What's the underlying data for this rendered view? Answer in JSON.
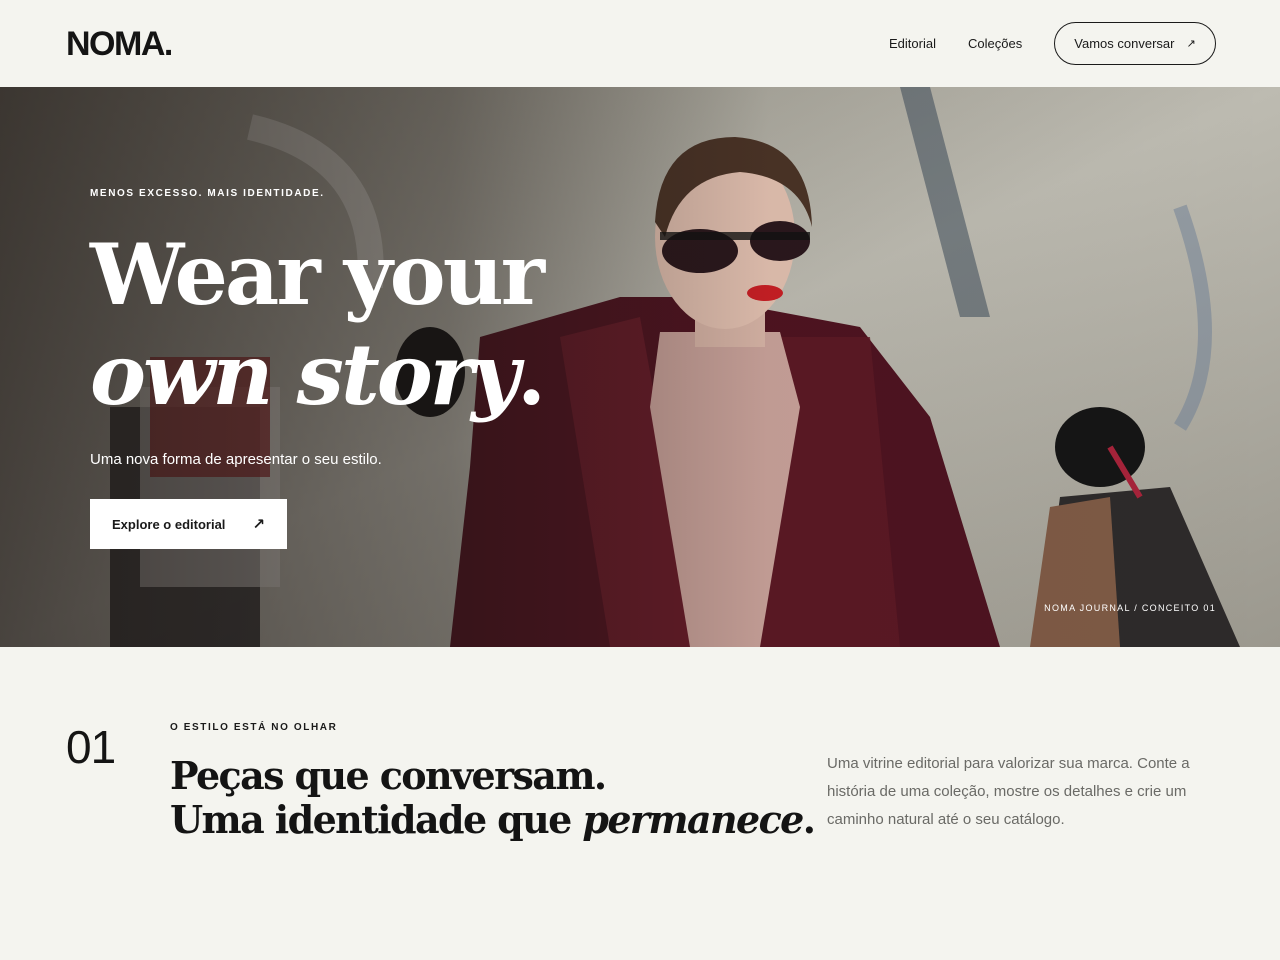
{
  "header": {
    "logo": "NOMA.",
    "nav": [
      {
        "label": "Editorial"
      },
      {
        "label": "Coleções"
      }
    ],
    "cta_label": "Vamos conversar",
    "cta_icon": "arrow-up-right-icon"
  },
  "hero": {
    "eyebrow": "MENOS EXCESSO. MAIS IDENTIDADE.",
    "headline_line1": "Wear your",
    "headline_line2_italic": "own story",
    "headline_line2_end": ".",
    "subline": "Uma nova forma de apresentar o seu estilo.",
    "button_label": "Explore o editorial",
    "button_icon": "arrow-up-right-icon",
    "caption": "NOMA JOURNAL / CONCEITO 01"
  },
  "section": {
    "number": "01",
    "kicker": "O ESTILO ESTÁ NO OLHAR",
    "title_line1": "Peças que conversam.",
    "title_line2_start": "Uma identidade que ",
    "title_line2_italic": "permanece",
    "title_line2_end": ".",
    "description": "Uma vitrine editorial para valorizar sua marca. Conte a história de uma coleção, mostre os detalhes e crie um caminho natural até o seu catálogo."
  },
  "colors": {
    "background": "#f4f4ef",
    "text": "#141414",
    "muted": "#6a6a66",
    "coat": "#5a1620",
    "accent_lips": "#c81e24"
  }
}
